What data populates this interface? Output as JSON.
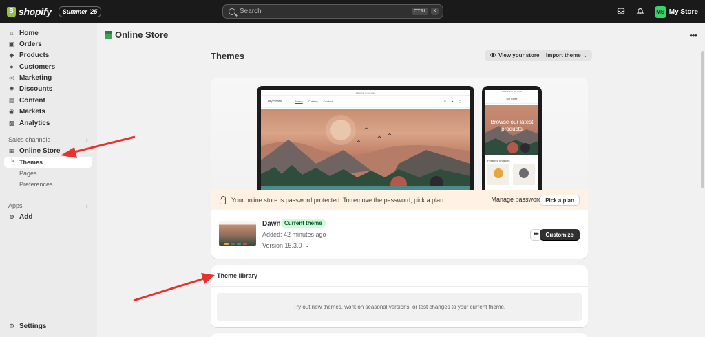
{
  "topbar": {
    "brand": "shopify",
    "edition": "Summer '25",
    "search_placeholder": "Search",
    "shortcut_keys": [
      "CTRL",
      "K"
    ],
    "store_initials": "MS",
    "store_name": "My Store"
  },
  "sidebar": {
    "items": [
      {
        "label": "Home",
        "icon": "home-icon"
      },
      {
        "label": "Orders",
        "icon": "orders-icon"
      },
      {
        "label": "Products",
        "icon": "tag-icon"
      },
      {
        "label": "Customers",
        "icon": "person-icon"
      },
      {
        "label": "Marketing",
        "icon": "target-icon"
      },
      {
        "label": "Discounts",
        "icon": "discount-icon"
      },
      {
        "label": "Content",
        "icon": "content-icon"
      },
      {
        "label": "Markets",
        "icon": "globe-icon"
      },
      {
        "label": "Analytics",
        "icon": "chart-icon"
      }
    ],
    "sales_channels_label": "Sales channels",
    "online_store_label": "Online Store",
    "sub_items": [
      "Themes",
      "Pages",
      "Preferences"
    ],
    "apps_label": "Apps",
    "add_label": "Add",
    "settings_label": "Settings"
  },
  "header": {
    "title": "Online Store"
  },
  "themes": {
    "title": "Themes",
    "view_store": "View your store",
    "import_theme": "Import theme",
    "preview": {
      "announcement": "Welcome to our store",
      "store_name": "My Store",
      "nav_links": [
        "Home",
        "Catalog",
        "Contact"
      ],
      "mobile_hero": "Browse our latest products",
      "featured_label": "Featured products"
    },
    "banner": {
      "text": "Your online store is password protected. To remove the password, pick a plan.",
      "manage_password": "Manage password",
      "pick_plan": "Pick a plan"
    },
    "current": {
      "name": "Dawn",
      "badge": "Current theme",
      "added": "Added: 42 minutes ago",
      "version": "Version 15.3.0",
      "customize": "Customize"
    }
  },
  "library": {
    "title": "Theme library",
    "empty_text": "Try out new themes, work on seasonal versions, or test changes to your current theme."
  },
  "colors": {
    "accent_dark": "#303030",
    "badge_bg": "#cdfed4",
    "banner_bg": "#fff1e3",
    "annotation_arrow": "#e8322b"
  }
}
